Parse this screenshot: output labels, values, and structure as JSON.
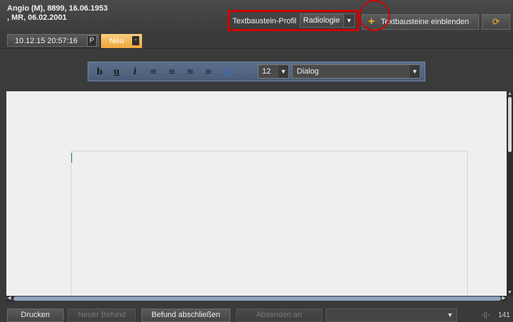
{
  "patient": {
    "line1": "Angio (M), 8899, 16.06.1953",
    "line2": ", MR, 06.02.2001"
  },
  "header": {
    "profile_label": "Textbaustein-Profil",
    "profile_value": "Radiologie",
    "show_button_label": "Textbausteine einblenden",
    "accent_color": "#f0b020",
    "highlight_color": "#d00000"
  },
  "tabs": {
    "report_tab": {
      "label": "10.12.15 20:57:16",
      "badge": "P"
    },
    "new_tab": {
      "label": "Neu",
      "badge": "-"
    }
  },
  "format_toolbar": {
    "buttons": [
      {
        "name": "bold",
        "glyph": "b"
      },
      {
        "name": "underline",
        "glyph": "u"
      },
      {
        "name": "italic",
        "glyph": "i"
      },
      {
        "name": "align-left",
        "glyph": "≡"
      },
      {
        "name": "align-center",
        "glyph": "≡"
      },
      {
        "name": "align-right",
        "glyph": "≡"
      },
      {
        "name": "justify",
        "glyph": "≡"
      },
      {
        "name": "font-color",
        "glyph": "A"
      }
    ],
    "font_size": "12",
    "font_family": "Dialog"
  },
  "footer": {
    "print_label": "Drucken",
    "new_report_label": "Neuer Befund",
    "finish_label": "Befund abschließen",
    "send_label": "Absenden an",
    "zoom_value": "141"
  }
}
